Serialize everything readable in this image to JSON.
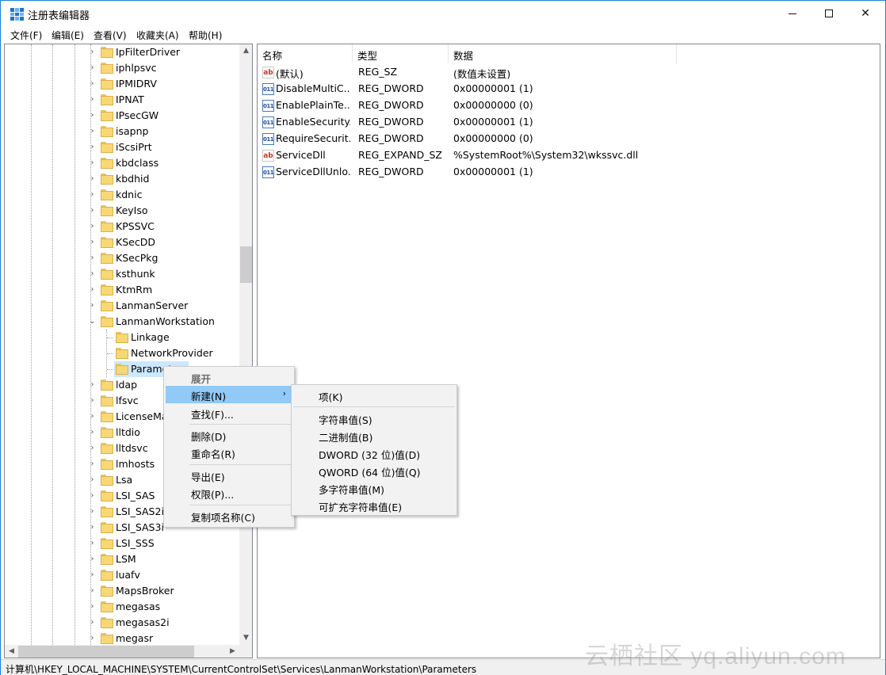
{
  "window": {
    "title": "注册表编辑器",
    "controls": {
      "minimize": "—",
      "maximize": "□",
      "close": "✕"
    }
  },
  "menubar": [
    "文件(F)",
    "编辑(E)",
    "查看(V)",
    "收藏夹(A)",
    "帮助(H)"
  ],
  "tree": {
    "items": [
      {
        "label": "IpFilterDriver",
        "expandable": true
      },
      {
        "label": "iphlpsvc",
        "expandable": true
      },
      {
        "label": "IPMIDRV",
        "expandable": true
      },
      {
        "label": "IPNAT",
        "expandable": true
      },
      {
        "label": "IPsecGW",
        "expandable": true
      },
      {
        "label": "isapnp",
        "expandable": true
      },
      {
        "label": "iScsiPrt",
        "expandable": true
      },
      {
        "label": "kbdclass",
        "expandable": true
      },
      {
        "label": "kbdhid",
        "expandable": true
      },
      {
        "label": "kdnic",
        "expandable": true
      },
      {
        "label": "KeyIso",
        "expandable": true
      },
      {
        "label": "KPSSVC",
        "expandable": true
      },
      {
        "label": "KSecDD",
        "expandable": true
      },
      {
        "label": "KSecPkg",
        "expandable": true
      },
      {
        "label": "ksthunk",
        "expandable": true
      },
      {
        "label": "KtmRm",
        "expandable": true
      },
      {
        "label": "LanmanServer",
        "expandable": true
      },
      {
        "label": "LanmanWorkstation",
        "expandable": true,
        "expanded": true
      },
      {
        "label": "Linkage",
        "child": true
      },
      {
        "label": "NetworkProvider",
        "child": true
      },
      {
        "label": "Paramet",
        "child": true,
        "selected": true
      },
      {
        "label": "ldap",
        "expandable": true
      },
      {
        "label": "lfsvc",
        "expandable": true
      },
      {
        "label": "LicenseMa",
        "expandable": true
      },
      {
        "label": "lltdio",
        "expandable": true
      },
      {
        "label": "lltdsvc",
        "expandable": true
      },
      {
        "label": "lmhosts",
        "expandable": true
      },
      {
        "label": "Lsa",
        "expandable": true
      },
      {
        "label": "LSI_SAS",
        "expandable": true
      },
      {
        "label": "LSI_SAS2i",
        "expandable": true
      },
      {
        "label": "LSI_SAS3i",
        "expandable": true
      },
      {
        "label": "LSI_SSS",
        "expandable": true
      },
      {
        "label": "LSM",
        "expandable": true
      },
      {
        "label": "luafv",
        "expandable": true
      },
      {
        "label": "MapsBroker",
        "expandable": true
      },
      {
        "label": "megasas",
        "expandable": true
      },
      {
        "label": "megasas2i",
        "expandable": true
      },
      {
        "label": "megasr",
        "expandable": true
      }
    ]
  },
  "list": {
    "columns": [
      "名称",
      "类型",
      "数据"
    ],
    "rows": [
      {
        "icon": "sz",
        "name": "(默认)",
        "type": "REG_SZ",
        "data": "(数值未设置)"
      },
      {
        "icon": "dw",
        "name": "DisableMultiC...",
        "type": "REG_DWORD",
        "data": "0x00000001 (1)"
      },
      {
        "icon": "dw",
        "name": "EnablePlainTe...",
        "type": "REG_DWORD",
        "data": "0x00000000 (0)"
      },
      {
        "icon": "dw",
        "name": "EnableSecurity...",
        "type": "REG_DWORD",
        "data": "0x00000001 (1)"
      },
      {
        "icon": "dw",
        "name": "RequireSecurit...",
        "type": "REG_DWORD",
        "data": "0x00000000 (0)"
      },
      {
        "icon": "sz",
        "name": "ServiceDll",
        "type": "REG_EXPAND_SZ",
        "data": "%SystemRoot%\\System32\\wkssvc.dll"
      },
      {
        "icon": "dw",
        "name": "ServiceDllUnlo...",
        "type": "REG_DWORD",
        "data": "0x00000001 (1)"
      }
    ]
  },
  "context_menu": {
    "expand": "展开",
    "new": "新建(N)",
    "find": "查找(F)...",
    "delete": "删除(D)",
    "rename": "重命名(R)",
    "export": "导出(E)",
    "permissions": "权限(P)...",
    "copy_key_name": "复制项名称(C)"
  },
  "submenu": {
    "key": "项(K)",
    "string": "字符串值(S)",
    "binary": "二进制值(B)",
    "dword": "DWORD (32 位)值(D)",
    "qword": "QWORD (64 位)值(Q)",
    "multi_string": "多字符串值(M)",
    "expandable_string": "可扩充字符串值(E)"
  },
  "status": "计算机\\HKEY_LOCAL_MACHINE\\SYSTEM\\CurrentControlSet\\Services\\LanmanWorkstation\\Parameters",
  "watermark": "云栖社区 yq.aliyun.com"
}
